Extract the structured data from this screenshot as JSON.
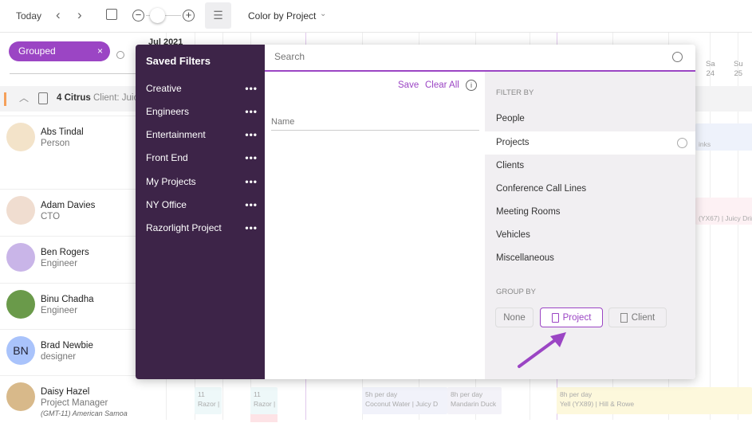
{
  "toolbar": {
    "today": "Today",
    "color_by": "Color by Project",
    "zoom_level": 0.2
  },
  "filter_chip": {
    "label": "Grouped"
  },
  "calendar": {
    "month": "Jul 2021",
    "days": [
      {
        "dow": "Sa",
        "date": "24"
      },
      {
        "dow": "Su",
        "date": "25"
      }
    ]
  },
  "group_row": {
    "title": "4 Citrus",
    "client": "Client: Juic",
    "accent": "#f5a05a"
  },
  "people": [
    {
      "name": "Abs Tindal",
      "role": "Person"
    },
    {
      "name": "Adam Davies",
      "role": "CTO"
    },
    {
      "name": "Ben Rogers",
      "role": "Engineer"
    },
    {
      "name": "Binu Chadha",
      "role": "Engineer"
    },
    {
      "name": "Brad Newbie",
      "role": "designer",
      "initials": "BN"
    },
    {
      "name": "Daisy Hazel",
      "role": "Project Manager",
      "timezone": "(GMT-11) American Samoa"
    }
  ],
  "bars": {
    "b1": "inks",
    "b2": "(YX67) | Juicy Drinks",
    "b3a": "11",
    "b3b": "Razor |",
    "b4a": "11",
    "b4b": "Razor |",
    "b5a": "5h per day",
    "b5b": "Coconut Water | Juicy D",
    "b6a": "8h per day",
    "b6b": "Mandarin Duck",
    "b7a": "8h per day",
    "b7b": "Yell (YX89) | Hill & Rowe"
  },
  "saved_filters": {
    "title": "Saved Filters",
    "items": [
      "Creative",
      "Engineers",
      "Entertainment",
      "Front End",
      "My Projects",
      "NY Office",
      "Razorlight Project"
    ]
  },
  "search": {
    "placeholder": "Search"
  },
  "actions": {
    "save": "Save",
    "clear_all": "Clear All"
  },
  "name_field": {
    "placeholder": "Name"
  },
  "filter_by": {
    "title": "FILTER BY",
    "items": [
      "People",
      "Projects",
      "Clients",
      "Conference Call Lines",
      "Meeting Rooms",
      "Vehicles",
      "Miscellaneous"
    ],
    "hovered": "Projects"
  },
  "group_by": {
    "title": "GROUP BY",
    "options": [
      "None",
      "Project",
      "Client"
    ],
    "selected": "Project"
  },
  "colors": {
    "accent": "#9b45c4",
    "sidebar": "#3d2448",
    "panel": "#f1eff2"
  }
}
